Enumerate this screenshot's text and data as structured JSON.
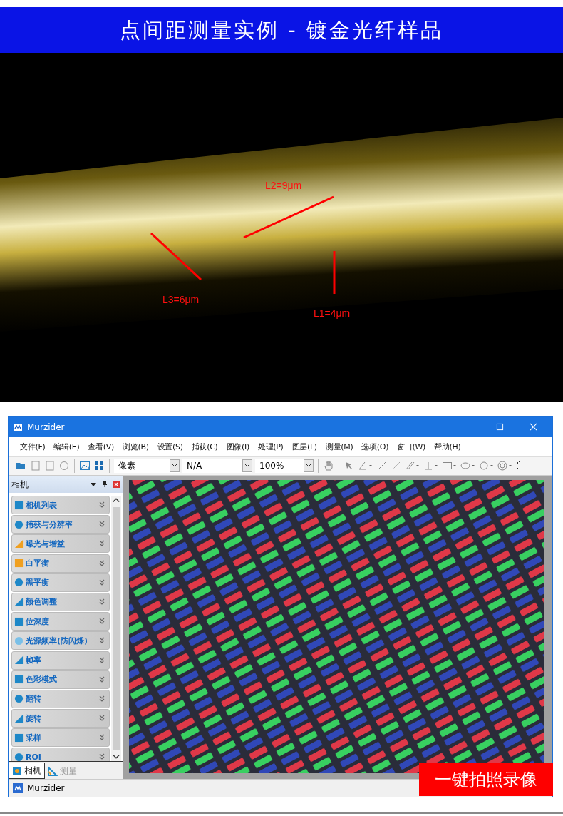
{
  "banner": {
    "title": "点间距测量实例 - 镀金光纤样品"
  },
  "micrograph": {
    "measurements": [
      {
        "label": "L2=9μm"
      },
      {
        "label": "L3=6μm"
      },
      {
        "label": "L1=4μm"
      }
    ]
  },
  "window": {
    "title": "Murzider",
    "menu": [
      "文件(F)",
      "编辑(E)",
      "查看(V)",
      "浏览(B)",
      "设置(S)",
      "捕获(C)",
      "图像(I)",
      "处理(P)",
      "图层(L)",
      "测量(M)",
      "选项(O)",
      "窗口(W)",
      "帮助(H)"
    ],
    "toolbar": {
      "dropdowns": [
        {
          "value": "像素"
        },
        {
          "value": "N/A"
        },
        {
          "value": "100%"
        }
      ]
    },
    "panel": {
      "title": "相机",
      "sections": [
        "相机列表",
        "捕获与分辨率",
        "曝光与增益",
        "白平衡",
        "黑平衡",
        "颜色调整",
        "位深度",
        "光源频率(防闪烁)",
        "帧率",
        "色彩模式",
        "翻转",
        "旋转",
        "采样",
        "ROI"
      ],
      "tabs": [
        {
          "label": "相机",
          "selected": true
        },
        {
          "label": "测量",
          "selected": false
        }
      ]
    },
    "status_bar": {
      "text": "Murzider"
    }
  },
  "badge": {
    "text": "一键拍照录像"
  }
}
